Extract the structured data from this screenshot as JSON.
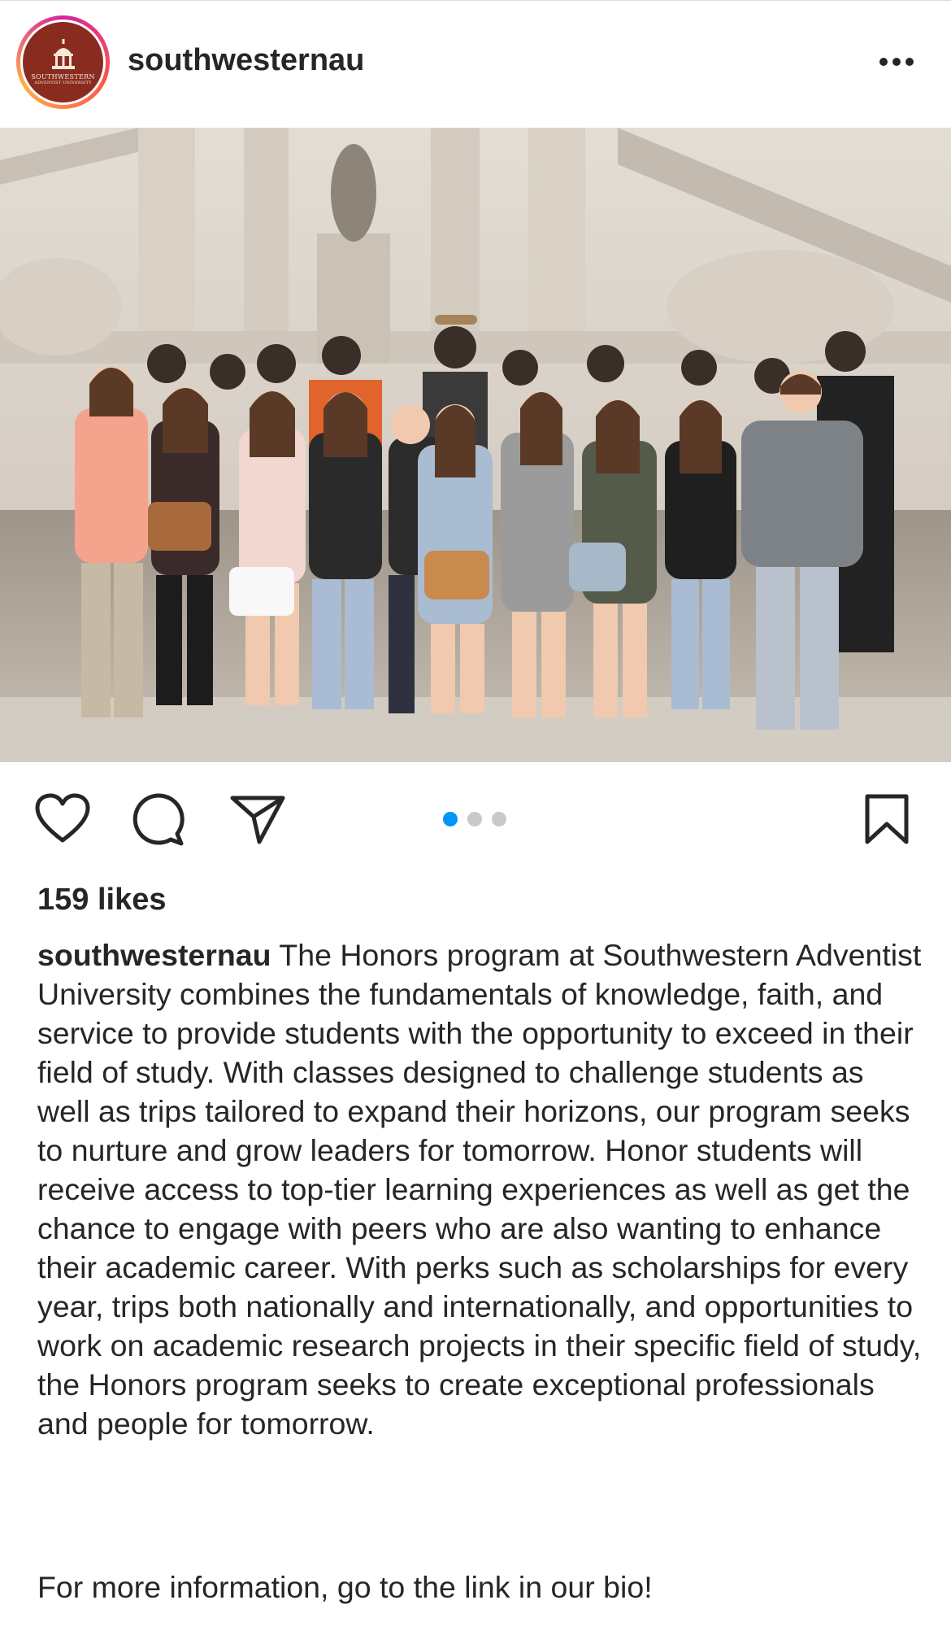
{
  "post": {
    "username": "southwesternau",
    "avatar": {
      "logo_text_1": "SOUTHWESTERN",
      "logo_text_2": "ADVENTIST UNIVERSITY",
      "bg_color": "#8a2b1f"
    },
    "more_icon": "more-horizontal-icon",
    "image_description_icon": "group-photo",
    "carousel": {
      "count": 3,
      "active_index": 0,
      "active_color": "#0095f6"
    },
    "actions": {
      "like_icon": "heart-icon",
      "comment_icon": "comment-icon",
      "share_icon": "send-icon",
      "save_icon": "bookmark-icon"
    },
    "likes": "159 likes",
    "caption_user": "southwesternau",
    "caption_text": " The Honors program at Southwestern Adventist University combines the fundamentals of knowledge, faith, and service to provide students with the opportunity to exceed in their field of study. With classes designed to challenge students as well as trips tailored to expand their horizons, our program seeks to nurture and grow leaders for tomorrow. Honor students will receive access to top-tier learning experiences as well as get the chance to engage with peers who are also wanting to enhance their academic career. With perks such as scholarships for every year, trips both nationally and internationally, and opportunities to work on academic research projects in their specific field of study, the Honors program seeks to create exceptional professionals and people for tomorrow.",
    "caption_cta": "For more information, go to the link in our bio!"
  }
}
